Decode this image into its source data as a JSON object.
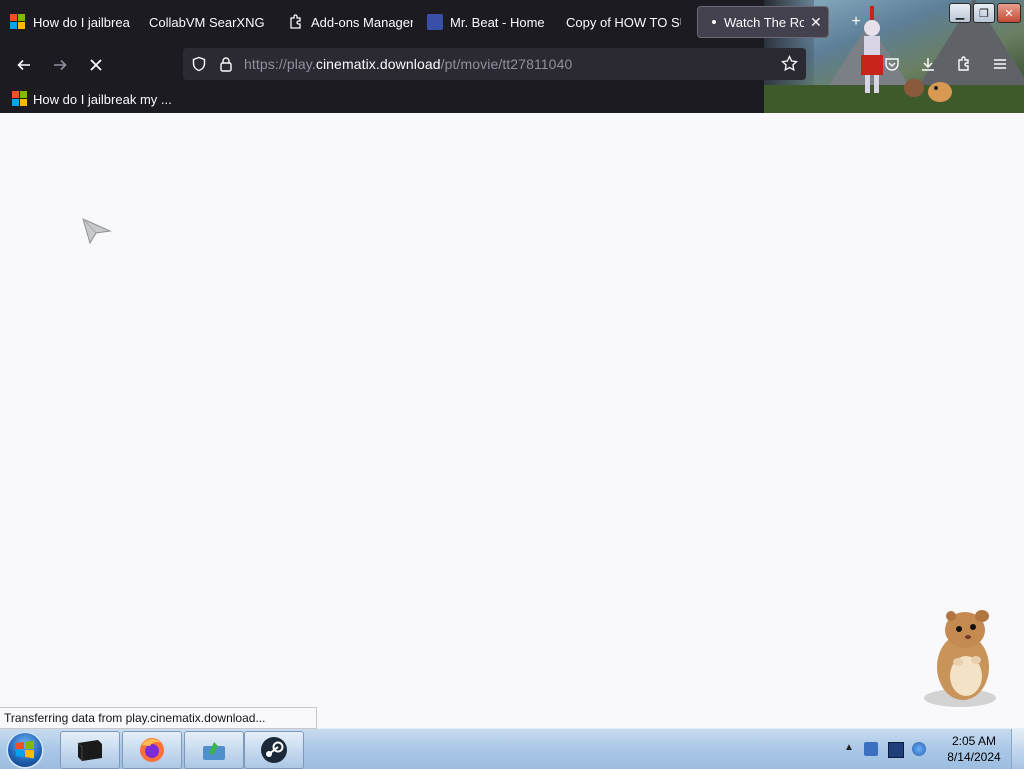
{
  "browser": {
    "tabs": [
      {
        "label": "How do I jailbreak",
        "icon": "microsoft-logo-icon"
      },
      {
        "label": "CollabVM SearXNG",
        "icon": ""
      },
      {
        "label": "Add-ons Manager",
        "icon": "puzzle-icon"
      },
      {
        "label": "Mr. Beat - Home",
        "icon": "site-favicon-icon"
      },
      {
        "label": "Copy of HOW TO SU",
        "icon": ""
      },
      {
        "label": "Watch The Ro",
        "icon": "loading-dot-icon",
        "active": true
      }
    ],
    "url": {
      "prefix": "https://play.",
      "host": "cinematix.download",
      "path": "/pt/movie/tt27811040"
    },
    "bookmarks": [
      {
        "label": "How do I jailbreak my ...",
        "icon": "microsoft-logo-icon"
      }
    ]
  },
  "status_bar": {
    "text": "Transferring data from play.cinematix.download..."
  },
  "taskbar": {
    "time": "2:05 AM",
    "date": "8/14/2024",
    "pinned": [
      "terminal-icon",
      "firefox-icon",
      "app-icon",
      "steam-icon"
    ]
  },
  "colors": {
    "chrome_bg": "#1c1b22",
    "urlbar_bg": "#2b2a33",
    "content_bg": "#f9f9fb",
    "taskbar_bg": "#aac7e6"
  }
}
